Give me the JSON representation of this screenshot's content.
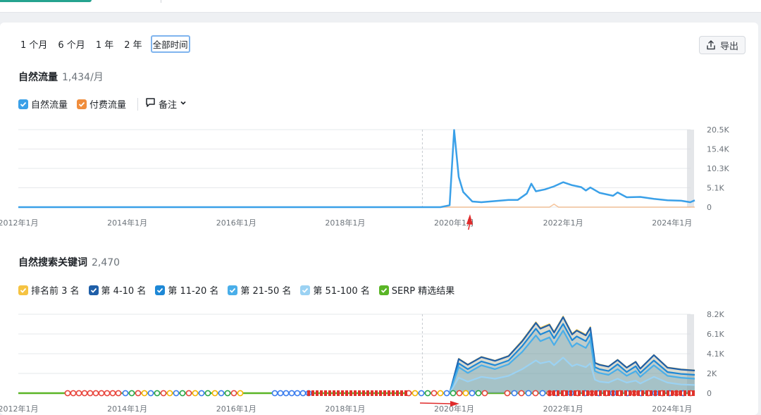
{
  "periods": [
    {
      "label": "1 个月",
      "active": false
    },
    {
      "label": "6 个月",
      "active": false
    },
    {
      "label": "1 年",
      "active": false
    },
    {
      "label": "2 年",
      "active": false
    },
    {
      "label": "全部时间",
      "active": true
    }
  ],
  "export_label": "导出",
  "traffic": {
    "title": "自然流量",
    "value": "1,434/月",
    "legend": [
      {
        "label": "自然流量",
        "color": "#3aa0e8"
      },
      {
        "label": "付费流量",
        "color": "#f08d3c"
      }
    ],
    "notes_label": "备注"
  },
  "keywords": {
    "title": "自然搜索关键词",
    "value": "2,470",
    "legend": [
      {
        "label": "排名前 3 名",
        "color": "#f5c342"
      },
      {
        "label": "第 4-10 名",
        "color": "#1f5fa8"
      },
      {
        "label": "第 11-20 名",
        "color": "#1e88d6"
      },
      {
        "label": "第 21-50 名",
        "color": "#49aee9"
      },
      {
        "label": "第 51-100 名",
        "color": "#9bd2f3"
      },
      {
        "label": "SERP 精选结果",
        "color": "#5ab526"
      }
    ]
  },
  "chart_data": [
    {
      "type": "line",
      "title": "",
      "x_tick_labels": [
        "2012年1月",
        "2014年1月",
        "2016年1月",
        "2018年1月",
        "2020年1月",
        "2022年1月",
        "2024年1月"
      ],
      "y_tick_labels": [
        "20.5K",
        "15.4K",
        "10.3K",
        "5.1K",
        "0"
      ],
      "ylim": [
        0,
        20500
      ],
      "xlim": [
        "2012-01",
        "2024-06"
      ],
      "grid": true,
      "series": [
        {
          "name": "自然流量",
          "color": "#3aa0e8",
          "points": [
            [
              "2012-01",
              0
            ],
            [
              "2019-10",
              0
            ],
            [
              "2019-12",
              500
            ],
            [
              "2020-01",
              20400
            ],
            [
              "2020-02",
              8000
            ],
            [
              "2020-03",
              4000
            ],
            [
              "2020-05",
              1500
            ],
            [
              "2020-07",
              1300
            ],
            [
              "2020-10",
              1600
            ],
            [
              "2021-01",
              1900
            ],
            [
              "2021-03",
              1900
            ],
            [
              "2021-05",
              3600
            ],
            [
              "2021-06",
              6200
            ],
            [
              "2021-07",
              4200
            ],
            [
              "2021-09",
              4700
            ],
            [
              "2021-11",
              5500
            ],
            [
              "2022-01",
              6600
            ],
            [
              "2022-03",
              5800
            ],
            [
              "2022-05",
              5300
            ],
            [
              "2022-06",
              4400
            ],
            [
              "2022-07",
              5200
            ],
            [
              "2022-09",
              3800
            ],
            [
              "2022-12",
              3000
            ],
            [
              "2023-01",
              3900
            ],
            [
              "2023-03",
              2600
            ],
            [
              "2023-06",
              2700
            ],
            [
              "2023-09",
              2200
            ],
            [
              "2023-12",
              1800
            ],
            [
              "2024-03",
              1700
            ],
            [
              "2024-05",
              1300
            ],
            [
              "2024-06",
              1800
            ]
          ]
        },
        {
          "name": "付费流量",
          "color": "#f08d3c",
          "points": [
            [
              "2012-01",
              0
            ],
            [
              "2021-10",
              0
            ],
            [
              "2021-11",
              800
            ],
            [
              "2021-12",
              0
            ],
            [
              "2024-06",
              0
            ]
          ]
        }
      ]
    },
    {
      "type": "area",
      "title": "",
      "x_tick_labels": [
        "2012年1月",
        "2014年1月",
        "2016年1月",
        "2018年1月",
        "2020年1月",
        "2022年1月",
        "2024年1月"
      ],
      "y_tick_labels": [
        "8.2K",
        "6.1K",
        "4.1K",
        "2K",
        "0"
      ],
      "ylim": [
        0,
        8200
      ],
      "xlim": [
        "2012-01",
        "2024-06"
      ],
      "grid": true,
      "stacked": true,
      "dates": [
        "2019-12",
        "2020-02",
        "2020-04",
        "2020-07",
        "2020-10",
        "2021-01",
        "2021-04",
        "2021-07",
        "2021-08",
        "2021-10",
        "2021-11",
        "2022-01",
        "2022-03",
        "2022-04",
        "2022-06",
        "2022-07",
        "2022-08",
        "2022-09",
        "2022-11",
        "2023-01",
        "2023-03",
        "2023-05",
        "2023-06",
        "2023-09",
        "2023-12",
        "2024-03",
        "2024-06"
      ],
      "cumulative_series": [
        {
          "name": "排名前 3 名",
          "color": "#f5c342",
          "values": [
            0,
            3600,
            3000,
            3800,
            3400,
            3900,
            5500,
            7400,
            6800,
            7200,
            6400,
            8000,
            6200,
            6600,
            6100,
            6900,
            3200,
            3000,
            2800,
            3500,
            2700,
            3300,
            2600,
            4000,
            2700,
            2500,
            2400
          ]
        },
        {
          "name": "第 4-10 名",
          "color": "#1f5fa8",
          "values": [
            0,
            3550,
            2950,
            3750,
            3350,
            3850,
            5400,
            7300,
            6700,
            7100,
            6300,
            7900,
            6100,
            6500,
            6000,
            6800,
            3150,
            2950,
            2750,
            3450,
            2650,
            3250,
            2550,
            3950,
            2650,
            2450,
            2350
          ]
        },
        {
          "name": "第 11-20 名",
          "color": "#1e88d6",
          "values": [
            0,
            3100,
            2500,
            3300,
            2900,
            3400,
            4900,
            6700,
            6100,
            6500,
            5700,
            7200,
            5500,
            5900,
            5400,
            6200,
            2700,
            2500,
            2300,
            3000,
            2200,
            2800,
            2100,
            3400,
            2200,
            2000,
            1900
          ]
        },
        {
          "name": "第 21-50 名",
          "color": "#49aee9",
          "values": [
            0,
            2700,
            2100,
            2900,
            2500,
            3000,
            4300,
            6000,
            5400,
            5800,
            5000,
            6500,
            4800,
            5200,
            4700,
            5500,
            2300,
            2100,
            1900,
            2500,
            1800,
            2300,
            1700,
            2900,
            1800,
            1600,
            1500
          ]
        },
        {
          "name": "第 51-100 名",
          "color": "#9bd2f3",
          "values": [
            0,
            1600,
            1200,
            1700,
            1500,
            1800,
            2500,
            3400,
            3100,
            3300,
            2900,
            3700,
            2800,
            3000,
            2700,
            3100,
            1400,
            1200,
            1100,
            1500,
            1100,
            1300,
            1000,
            1700,
            1100,
            900,
            850
          ]
        }
      ],
      "serp_line": {
        "name": "SERP 精选结果",
        "color": "#5ab526",
        "value": 0
      }
    }
  ]
}
